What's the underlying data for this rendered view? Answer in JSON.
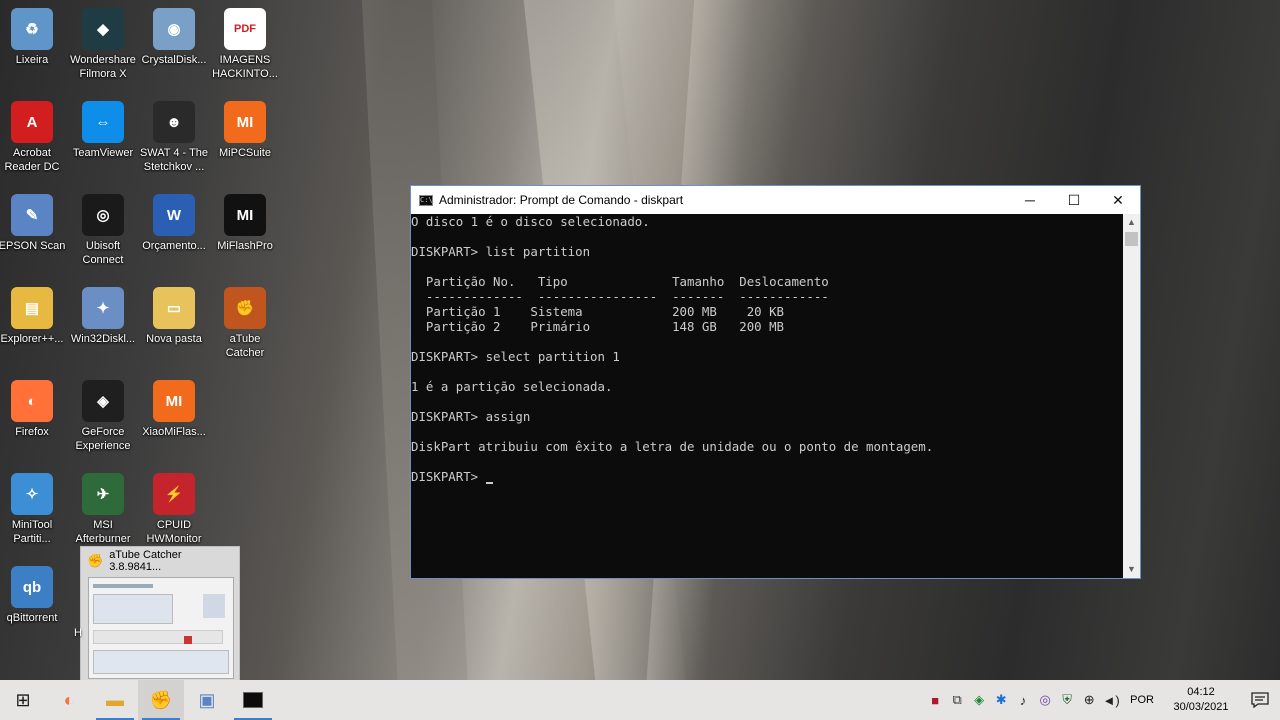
{
  "desktop": {
    "icons": [
      {
        "label": "Lixeira",
        "icon": "recycle-bin-icon",
        "color": "#5f95c8",
        "glyph": "♻"
      },
      {
        "label": "Wondershare\nFilmora X",
        "icon": "filmora-icon",
        "color": "#1f3c44",
        "glyph": "◆"
      },
      {
        "label": "CrystalDisk...",
        "icon": "crystaldisk-icon",
        "color": "#7aa0c8",
        "glyph": "◉"
      },
      {
        "label": "IMAGENS\nHACKINTO...",
        "icon": "pdf-file-icon",
        "color": "#ffffff",
        "glyph": "PDF"
      },
      {
        "label": "Acrobat\nReader DC",
        "icon": "acrobat-icon",
        "color": "#d21e1e",
        "glyph": "A"
      },
      {
        "label": "TeamViewer",
        "icon": "teamviewer-icon",
        "color": "#0e8ee9",
        "glyph": "⇔"
      },
      {
        "label": "SWAT 4 - The\nStetchkov ...",
        "icon": "swat4-icon",
        "color": "#2a2a2a",
        "glyph": "☻"
      },
      {
        "label": "MiPCSuite",
        "icon": "mipcsuite-icon",
        "color": "#f26b1d",
        "glyph": "MI"
      },
      {
        "label": "EPSON Scan",
        "icon": "epson-scan-icon",
        "color": "#5a84c4",
        "glyph": "✎"
      },
      {
        "label": "Ubisoft\nConnect",
        "icon": "ubisoft-icon",
        "color": "#1a1a1a",
        "glyph": "◎"
      },
      {
        "label": "Orçamento...",
        "icon": "word-doc-icon",
        "color": "#2b5fb4",
        "glyph": "W"
      },
      {
        "label": "MiFlashPro",
        "icon": "miflashpro-icon",
        "color": "#111111",
        "glyph": "MI"
      },
      {
        "label": "Explorer++...",
        "icon": "explorer-plus-icon",
        "color": "#e7b941",
        "glyph": "▤"
      },
      {
        "label": "Win32Diskl...",
        "icon": "win32disk-icon",
        "color": "#6b8fc4",
        "glyph": "✦"
      },
      {
        "label": "Nova pasta",
        "icon": "folder-icon",
        "color": "#e8c25a",
        "glyph": "▭"
      },
      {
        "label": "aTube\nCatcher",
        "icon": "atube-catcher-icon",
        "color": "#c0561d",
        "glyph": "✊"
      },
      {
        "label": "Firefox",
        "icon": "firefox-icon",
        "color": "#ff7139",
        "glyph": "◐"
      },
      {
        "label": "GeForce\nExperience",
        "icon": "geforce-icon",
        "color": "#1f1f1f",
        "glyph": "◈"
      },
      {
        "label": "XiaoMiFlas...",
        "icon": "xiaomiflash-icon",
        "color": "#f26b1d",
        "glyph": "MI"
      },
      {
        "label": "MiniTool\nPartiti...",
        "icon": "minitool-icon",
        "color": "#3c8fd4",
        "glyph": "✧"
      },
      {
        "label": "MSI\nAfterburner",
        "icon": "msi-afterburner-icon",
        "color": "#2f6a3a",
        "glyph": "✈"
      },
      {
        "label": "CPUID\nHWMonitor",
        "icon": "hwmonitor-icon",
        "color": "#c5242c",
        "glyph": "⚡"
      },
      {
        "label": "qBittorrent",
        "icon": "qbittorrent-icon",
        "color": "#3d7fc4",
        "glyph": "qb"
      }
    ]
  },
  "preview": {
    "title": "aTube Catcher 3.8.9841...",
    "icon": "atube-catcher-icon",
    "partial_label": "H"
  },
  "cmd": {
    "title": "Administrador: Prompt de Comando - diskpart",
    "icon": "cmd-icon",
    "icon_glyph": "C:\\",
    "minimize": "─",
    "maximize": "☐",
    "close": "✕",
    "lines": [
      "O disco 1 é o disco selecionado.",
      "",
      "DISKPART> list partition",
      "",
      "  Partição No.   Tipo              Tamanho  Deslocamento",
      "  -------------  ----------------  -------  ------------",
      "  Partição 1    Sistema            200 MB    20 KB",
      "  Partição 2    Primário           148 GB   200 MB",
      "",
      "DISKPART> select partition 1",
      "",
      "1 é a partição selecionada.",
      "",
      "DISKPART> assign",
      "",
      "DiskPart atribuiu com êxito a letra de unidade ou o ponto de montagem.",
      "",
      "DISKPART> "
    ]
  },
  "taskbar": {
    "buttons": [
      {
        "icon": "windows-start-icon",
        "glyph": "⊞",
        "color": "#1a1a1a"
      },
      {
        "icon": "firefox-icon",
        "glyph": "◐",
        "color": "#ff7139"
      },
      {
        "icon": "file-explorer-icon",
        "glyph": "▬",
        "color": "#e0a82e"
      },
      {
        "icon": "atube-catcher-icon",
        "glyph": "✊",
        "color": "#c0561d"
      },
      {
        "icon": "control-panel-icon",
        "glyph": "▣",
        "color": "#5a84c4"
      },
      {
        "icon": "cmd-icon",
        "glyph": "▮",
        "color": "#0c0c0c"
      }
    ],
    "tray_icons": [
      {
        "icon": "red-app-icon",
        "glyph": "■",
        "color": "#b0182a"
      },
      {
        "icon": "usb-device-icon",
        "glyph": "⧉",
        "color": "#333333"
      },
      {
        "icon": "nvidia-icon",
        "glyph": "◈",
        "color": "#1e8a2e"
      },
      {
        "icon": "bluetooth-icon",
        "glyph": "✱",
        "color": "#1a6ed8"
      },
      {
        "icon": "microphone-icon",
        "glyph": "♪",
        "color": "#222222"
      },
      {
        "icon": "disk-icon",
        "glyph": "◎",
        "color": "#6a3fa0"
      },
      {
        "icon": "security-shield-icon",
        "glyph": "⛨",
        "color": "#2f6a3a"
      },
      {
        "icon": "network-globe-icon",
        "glyph": "⊕",
        "color": "#222222"
      },
      {
        "icon": "volume-icon",
        "glyph": "◄)",
        "color": "#222222"
      }
    ],
    "language": "POR",
    "time": "04:12",
    "date": "30/03/2021",
    "notification_icon": "notification-icon"
  }
}
